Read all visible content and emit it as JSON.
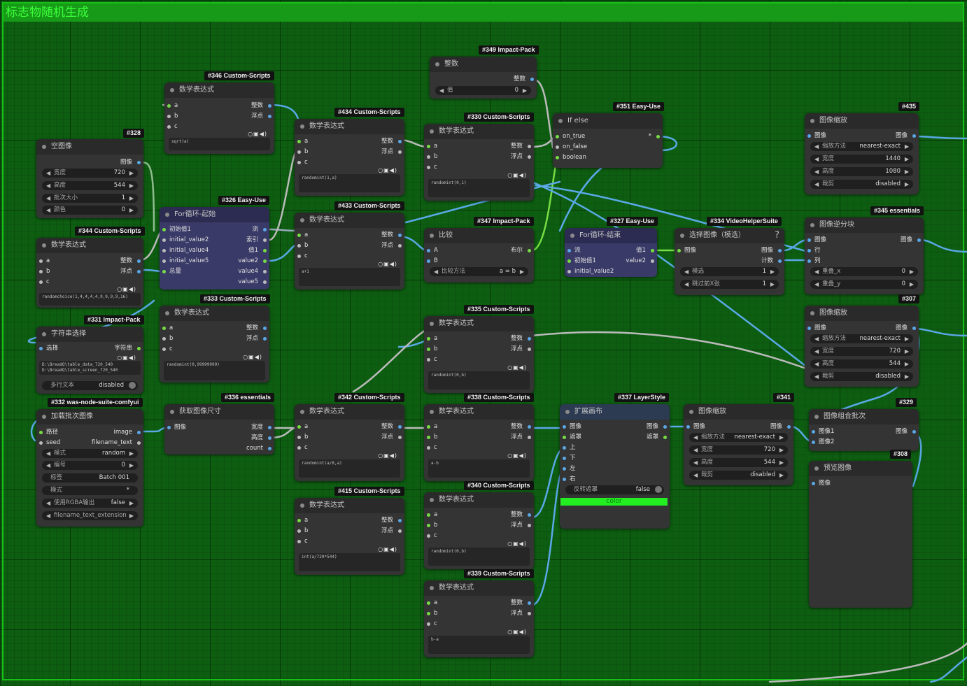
{
  "group": {
    "title": "标志物随机生成"
  },
  "nodes": {
    "n328": {
      "badge": "#328",
      "title": "空图像",
      "out_image": "图像",
      "w": [
        {
          "label": "宽度",
          "value": "720"
        },
        {
          "label": "高度",
          "value": "544"
        },
        {
          "label": "批次大小",
          "value": "1"
        },
        {
          "label": "颜色",
          "value": "0"
        }
      ]
    },
    "n346": {
      "badge": "#346 Custom-Scripts",
      "title": "数学表达式",
      "in": [
        "a",
        "b",
        "c"
      ],
      "out": [
        "整数",
        "浮点"
      ],
      "code": "sqrt(a)"
    },
    "n344": {
      "badge": "#344 Custom-Scripts",
      "title": "数学表达式",
      "in": [
        "a",
        "b",
        "c"
      ],
      "out": [
        "整数",
        "浮点"
      ],
      "code": "randomchoice(1,4,4,4,4,9,9,9,9,16)"
    },
    "n326": {
      "badge": "#326 Easy-Use",
      "title": "For循环-起始",
      "in": [
        "初始值1",
        "initial_value2",
        "initial_value4",
        "initial_value5",
        "总量"
      ],
      "out": [
        "流",
        "索引",
        "值1",
        "value2",
        "value4",
        "value5"
      ]
    },
    "n331": {
      "badge": "#331 Impact-Pack",
      "title": "字符串选择",
      "in_select": "选择",
      "out_str": "字符串",
      "code": "D:\\BreadQ\\table_data_720_540\nD:\\BreadQ\\table_screen_720_540",
      "toggle_label": "多行文本",
      "toggle_value": "disabled"
    },
    "n333": {
      "badge": "#333 Custom-Scripts",
      "title": "数学表达式",
      "in": [
        "a",
        "b",
        "c"
      ],
      "out": [
        "整数",
        "浮点"
      ],
      "code": "randomint(0,99999999)"
    },
    "n332": {
      "badge": "#332 was-node-suite-comfyui",
      "title": "加载批次图像",
      "in": [
        "路径",
        "seed"
      ],
      "out": [
        "image",
        "filename_text"
      ],
      "w": [
        {
          "label": "模式",
          "value": "random"
        },
        {
          "label": "编号",
          "value": "0"
        },
        {
          "label": "标签",
          "value": "Batch 001"
        },
        {
          "label": "模式",
          "value": "*"
        },
        {
          "label": "使用RGBA输出",
          "value": "false"
        },
        {
          "label": "filename_text_extension",
          "value": ""
        }
      ]
    },
    "n336": {
      "badge": "#336 essentials",
      "title": "获取图像尺寸",
      "in_image": "图像",
      "out": [
        "宽度",
        "高度",
        "count"
      ]
    },
    "n434": {
      "badge": "#434 Custom-Scripts",
      "title": "数学表达式",
      "in": [
        "a",
        "b",
        "c"
      ],
      "out": [
        "整数",
        "浮点"
      ],
      "code": "randomint(1,a)"
    },
    "n433": {
      "badge": "#433 Custom-Scripts",
      "title": "数学表达式",
      "in": [
        "a",
        "b",
        "c"
      ],
      "out": [
        "整数",
        "浮点"
      ],
      "code": "a+1"
    },
    "n342": {
      "badge": "#342 Custom-Scripts",
      "title": "数学表达式",
      "in": [
        "a",
        "b",
        "c"
      ],
      "out": [
        "整数",
        "浮点"
      ],
      "code": "randomint(a/8,a)"
    },
    "n415": {
      "badge": "#415 Custom-Scripts",
      "title": "数学表达式",
      "in": [
        "a",
        "b",
        "c"
      ],
      "out": [
        "整数",
        "浮点"
      ],
      "code": "int(a/720*544)"
    },
    "n349": {
      "badge": "#349 Impact-Pack",
      "title": "整数",
      "out": "整数",
      "w_label": "值",
      "w_value": "0"
    },
    "n330": {
      "badge": "#330 Custom-Scripts",
      "title": "数学表达式",
      "in": [
        "a",
        "b",
        "c"
      ],
      "out": [
        "整数",
        "浮点"
      ],
      "code": "randomint(0,1)"
    },
    "n347": {
      "badge": "#347 Impact-Pack",
      "title": "比较",
      "in": [
        "A",
        "B"
      ],
      "out": "布尔",
      "w_label": "比较方法",
      "w_value": "a = b"
    },
    "n335": {
      "badge": "#335 Custom-Scripts",
      "title": "数学表达式",
      "in": [
        "a",
        "b",
        "c"
      ],
      "out": [
        "整数",
        "浮点"
      ],
      "code": "randomint(0,b)"
    },
    "n338": {
      "badge": "#338 Custom-Scripts",
      "title": "数学表达式",
      "in": [
        "a",
        "b",
        "c"
      ],
      "out": [
        "整数",
        "浮点"
      ],
      "code": "a-b"
    },
    "n340": {
      "badge": "#340 Custom-Scripts",
      "title": "数学表达式",
      "in": [
        "a",
        "b",
        "c"
      ],
      "out": [
        "整数",
        "浮点"
      ],
      "code": "randomint(0,b)"
    },
    "n339": {
      "badge": "#339 Custom-Scripts",
      "title": "数学表达式",
      "in": [
        "a",
        "b",
        "c"
      ],
      "out": [
        "整数",
        "浮点"
      ],
      "code": "b-a"
    },
    "n351": {
      "badge": "#351 Easy-Use",
      "title": "If else",
      "in": [
        "on_true",
        "on_false",
        "boolean"
      ],
      "out": "*"
    },
    "n327": {
      "badge": "#327 Easy-Use",
      "title": "For循环-结束",
      "in": [
        "流",
        "初始值1",
        "initial_value2"
      ],
      "out": [
        "值1",
        "value2"
      ]
    },
    "n334": {
      "badge": "#334 VideoHelperSuite",
      "title": "选择图像（模选）",
      "help": "?",
      "in_image": "图像",
      "out": [
        "图像",
        "计数"
      ],
      "w": [
        {
          "label": "模选",
          "value": "1"
        },
        {
          "label": "跳过前X张",
          "value": "1"
        }
      ]
    },
    "n337": {
      "badge": "#337 LayerStyle",
      "title": "扩展画布",
      "in": [
        "图像",
        "遮罩",
        "上",
        "下",
        "左",
        "右"
      ],
      "out": [
        "图像",
        "遮罩"
      ],
      "toggle_label": "反转遮罩",
      "toggle_value": "false",
      "color_label": "color",
      "color_value": "#22ee22"
    },
    "n341": {
      "badge": "#341",
      "title": "图像缩放",
      "in_image": "图像",
      "out_image": "图像",
      "w": [
        {
          "label": "缩放方法",
          "value": "nearest-exact"
        },
        {
          "label": "宽度",
          "value": "720"
        },
        {
          "label": "高度",
          "value": "544"
        },
        {
          "label": "裁剪",
          "value": "disabled"
        }
      ]
    },
    "n435": {
      "badge": "#435",
      "title": "图像缩放",
      "in_image": "图像",
      "out_image": "图像",
      "w": [
        {
          "label": "缩放方法",
          "value": "nearest-exact"
        },
        {
          "label": "宽度",
          "value": "1440"
        },
        {
          "label": "高度",
          "value": "1080"
        },
        {
          "label": "裁剪",
          "value": "disabled"
        }
      ]
    },
    "n345": {
      "badge": "#345 essentials",
      "title": "图像逆分块",
      "in": [
        "图像",
        "行",
        "列"
      ],
      "out_image": "图像",
      "w": [
        {
          "label": "重叠_x",
          "value": "0"
        },
        {
          "label": "重叠_y",
          "value": "0"
        }
      ]
    },
    "n307": {
      "badge": "#307",
      "title": "图像缩放",
      "in_image": "图像",
      "out_image": "图像",
      "w": [
        {
          "label": "缩放方法",
          "value": "nearest-exact"
        },
        {
          "label": "宽度",
          "value": "720"
        },
        {
          "label": "高度",
          "value": "544"
        },
        {
          "label": "裁剪",
          "value": "disabled"
        }
      ]
    },
    "n329": {
      "badge": "#329",
      "title": "图像组合批次",
      "in": [
        "图像1",
        "图像2"
      ],
      "out_image": "图像"
    },
    "n308": {
      "badge": "#308",
      "title": "预览图像",
      "in_image": "图像"
    }
  }
}
